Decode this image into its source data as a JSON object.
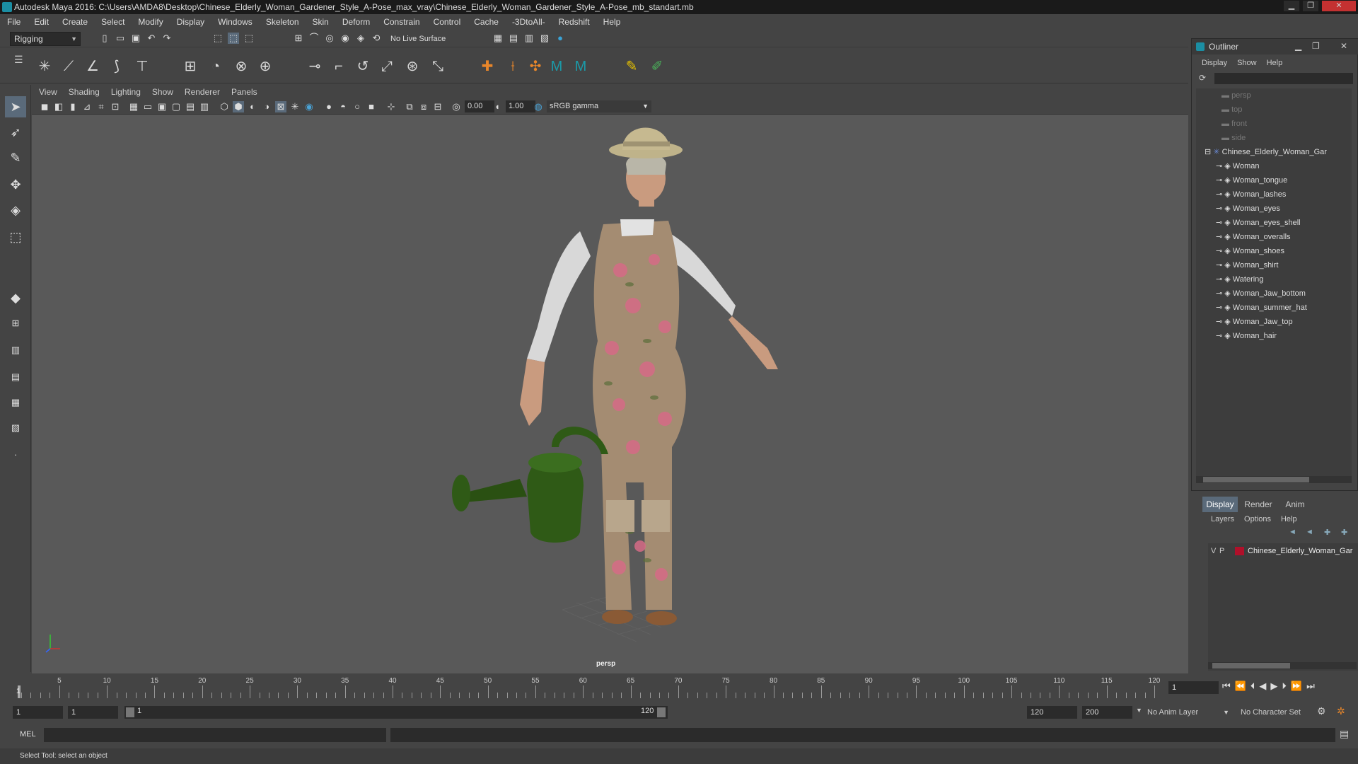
{
  "window": {
    "title": "Autodesk Maya 2016: C:\\Users\\AMDA8\\Desktop\\Chinese_Elderly_Woman_Gardener_Style_A-Pose_max_vray\\Chinese_Elderly_Woman_Gardener_Style_A-Pose_mb_standart.mb",
    "minimize": "▁",
    "restore": "❐",
    "close": "✕"
  },
  "menubar": [
    "File",
    "Edit",
    "Create",
    "Select",
    "Modify",
    "Display",
    "Windows",
    "Skeleton",
    "Skin",
    "Deform",
    "Constrain",
    "Control",
    "Cache",
    "-3DtoAll-",
    "Redshift",
    "Help"
  ],
  "statusline": {
    "menuset": "Rigging",
    "live_surface": "No Live Surface"
  },
  "panel": {
    "menu": [
      "View",
      "Shading",
      "Lighting",
      "Show",
      "Renderer",
      "Panels"
    ],
    "exposure": "0.00",
    "gamma": "1.00",
    "color_space": "sRGB gamma",
    "camera_label": "persp"
  },
  "outliner": {
    "title": "Outliner",
    "menu": [
      "Display",
      "Show",
      "Help"
    ],
    "cameras": [
      "persp",
      "top",
      "front",
      "side"
    ],
    "group": "Chinese_Elderly_Woman_Gar",
    "children": [
      "Woman",
      "Woman_tongue",
      "Woman_lashes",
      "Woman_eyes",
      "Woman_eyes_shell",
      "Woman_overalls",
      "Woman_shoes",
      "Woman_shirt",
      "Watering",
      "Woman_Jaw_bottom",
      "Woman_summer_hat",
      "Woman_Jaw_top",
      "Woman_hair"
    ]
  },
  "layers": {
    "tabs": [
      "Display",
      "Render",
      "Anim"
    ],
    "active_tab": "Display",
    "menu": [
      "Layers",
      "Options",
      "Help"
    ],
    "layer": {
      "v": "V",
      "p": "P",
      "name": "Chinese_Elderly_Woman_Gar",
      "color": "#b0102a"
    }
  },
  "timeline": {
    "ticks": [
      5,
      10,
      15,
      20,
      25,
      30,
      35,
      40,
      45,
      50,
      55,
      60,
      65,
      70,
      75,
      80,
      85,
      90,
      95,
      100,
      105,
      110,
      115,
      120
    ],
    "start_label": "1",
    "current_frame": "1"
  },
  "range": {
    "start": "1",
    "playback_start": "1",
    "slider_start": "1",
    "slider_end": "120",
    "playback_end": "120",
    "end": "200",
    "anim_layer": "No Anim Layer",
    "character_set": "No Character Set"
  },
  "cmdline": {
    "label": "MEL"
  },
  "helpline": {
    "text": "Select Tool: select an object"
  },
  "colors": {
    "accent": "#5a6a7a",
    "viewport_bg": "#595959",
    "can_green": "#2f5a16"
  }
}
